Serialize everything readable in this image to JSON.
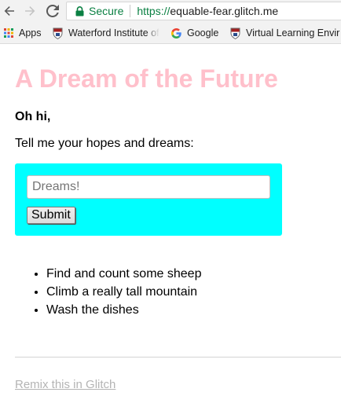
{
  "browser": {
    "secure_label": "Secure",
    "url_scheme": "https://",
    "url_host": "equable-fear.glitch.me",
    "bookmarks": [
      {
        "label": "Apps",
        "icon": "apps-grid-icon"
      },
      {
        "label": "Waterford Institute of",
        "icon": "crest-icon"
      },
      {
        "label": "Google",
        "icon": "google-icon"
      },
      {
        "label": "Virtual Learning Envir",
        "icon": "crest-icon"
      }
    ]
  },
  "page": {
    "title": "A Dream of the Future",
    "greeting": "Oh hi,",
    "prompt": "Tell me your hopes and dreams:",
    "form": {
      "input_placeholder": "Dreams!",
      "input_value": "",
      "submit_label": "Submit"
    },
    "dreams": [
      "Find and count some sheep",
      "Climb a really tall mountain",
      "Wash the dishes"
    ],
    "remix_link": "Remix this in Glitch"
  },
  "colors": {
    "title": "#ffc0cb",
    "form_background": "#00ffff",
    "secure_green": "#0b8043",
    "remix_link": "#b4b4b4"
  }
}
